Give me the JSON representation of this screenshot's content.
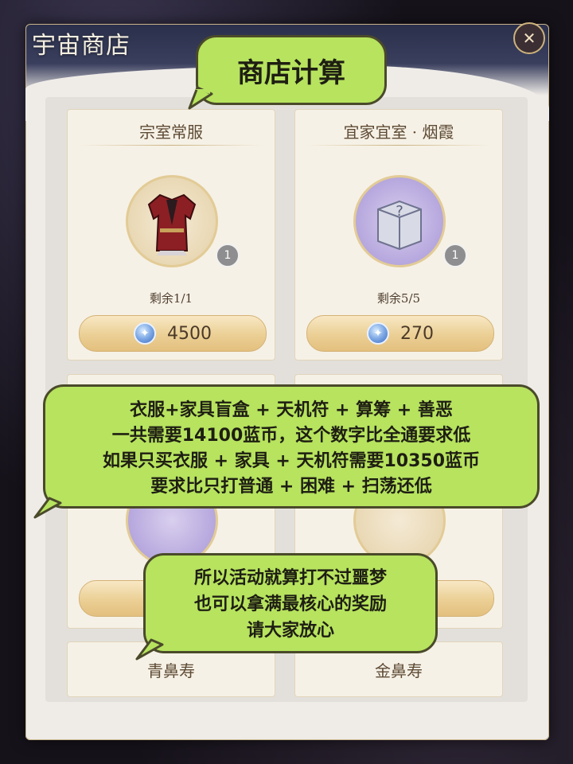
{
  "shop": {
    "title": "宇宙商店",
    "close_icon": "close-icon",
    "items": [
      {
        "name": "宗室常服",
        "remain": "剩余1/1",
        "price": "4500",
        "count": "1",
        "icon": "robe-icon"
      },
      {
        "name": "宜家宜室 · 烟霞",
        "remain": "剩余5/5",
        "price": "270",
        "count": "1",
        "icon": "mystery-box-icon"
      },
      {
        "name": "青鼻寿",
        "icon": "hidden-item-icon"
      },
      {
        "name": "金鼻寿",
        "icon": "hidden-item-icon"
      }
    ],
    "currency_icon": "blue-coin-icon"
  },
  "annotations": {
    "heading": "商店计算",
    "middle": [
      "衣服+家具盲盒 + 天机符 + 算筹 + 善恶",
      "一共需要14100蓝币，这个数字比全通要求低",
      "如果只买衣服 + 家具 + 天机符需要10350蓝币",
      "要求比只打普通 + 困难 + 扫荡还低"
    ],
    "bottom": [
      "所以活动就算打不过噩梦",
      "也可以拿满最核心的奖励",
      "请大家放心"
    ]
  },
  "colors": {
    "bubble_green": "#b7e35f",
    "bubble_border": "#4a4a2a",
    "card_bg": "#f6f1e6",
    "price_gold": "#e3c07e"
  }
}
